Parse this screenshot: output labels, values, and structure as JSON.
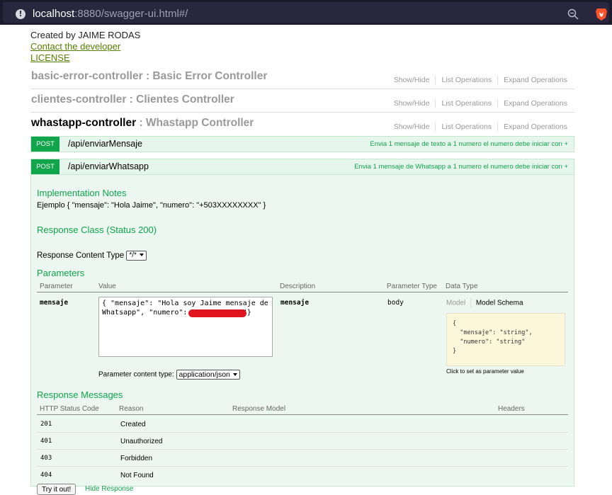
{
  "browser": {
    "url_host": "localhost",
    "url_rest": ":8880/swagger-ui.html#/",
    "info_icon": "info-icon",
    "zoom_icon": "zoom-icon",
    "brave_icon": "brave-lion-icon"
  },
  "info": {
    "created_by": "Created by JAIME RODAS",
    "contact": "Contact the developer",
    "license": "LICENSE"
  },
  "controllers": [
    {
      "key": "basic-error-controller",
      "desc": " : Basic Error Controller"
    },
    {
      "key": "clientes-controller",
      "desc": " : Clientes Controller"
    },
    {
      "key": "whastapp-controller",
      "desc": " : Whastapp Controller"
    }
  ],
  "ops_labels": {
    "show_hide": "Show/Hide",
    "list": "List Operations",
    "expand": "Expand Operations"
  },
  "operations": [
    {
      "verb": "POST",
      "path": "/api/enviarMensaje",
      "summary": "Envia 1 mensaje de texto a 1 numero el numero debe iniciar con +"
    },
    {
      "verb": "POST",
      "path": "/api/enviarWhatsapp",
      "summary": "Envia 1 mensaje de Whatsapp a 1 numero el numero debe iniciar con +"
    }
  ],
  "body": {
    "impl_title": "Implementation Notes",
    "impl_text": "Ejemplo { \"mensaje\": \"Hola Jaime\", \"numero\": \"+503XXXXXXXX\" }",
    "resp_class": "Response Class (Status 200)",
    "content_type_label": "Response Content Type",
    "content_type_value": "*/*",
    "params_title": "Parameters",
    "param_headers": [
      "Parameter",
      "Value",
      "Description",
      "Parameter Type",
      "Data Type"
    ],
    "param": {
      "name": "mensaje",
      "value": "{ \"mensaje\": \"Hola soy Jaime mensaje de Whatsapp\", \"numero\": \"           \"}",
      "description": "mensaje",
      "type": "body"
    },
    "model_tab": "Model",
    "schema_tab": "Model Schema",
    "schema": "{\n  \"mensaje\": \"string\",\n  \"numero\": \"string\"\n}",
    "schema_hint": "Click to set as parameter value",
    "param_ct_label": "Parameter content type:",
    "param_ct_value": "application/json",
    "resp_title": "Response Messages",
    "resp_headers": [
      "HTTP Status Code",
      "Reason",
      "Response Model",
      "Headers"
    ],
    "responses": [
      {
        "code": "201",
        "reason": "Created"
      },
      {
        "code": "401",
        "reason": "Unauthorized"
      },
      {
        "code": "403",
        "reason": "Forbidden"
      },
      {
        "code": "404",
        "reason": "Not Found"
      }
    ],
    "try_button": "Try it out!",
    "hide_response": "Hide Response"
  }
}
